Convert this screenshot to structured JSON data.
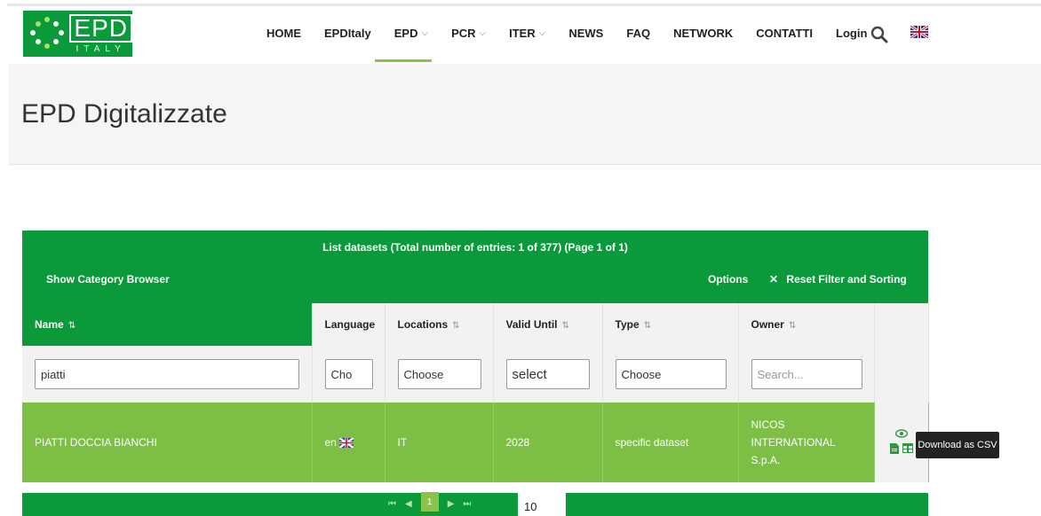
{
  "logo": {
    "main": "EPD",
    "sub": "ITALY"
  },
  "nav": {
    "items": [
      {
        "label": "HOME",
        "dropdown": false
      },
      {
        "label": "EPDItaly",
        "dropdown": false
      },
      {
        "label": "EPD",
        "dropdown": true
      },
      {
        "label": "PCR",
        "dropdown": true
      },
      {
        "label": "ITER",
        "dropdown": true
      },
      {
        "label": "NEWS",
        "dropdown": false
      },
      {
        "label": "FAQ",
        "dropdown": false
      },
      {
        "label": "NETWORK",
        "dropdown": false
      },
      {
        "label": "CONTATTI",
        "dropdown": false
      },
      {
        "label": "Login",
        "dropdown": false
      }
    ],
    "chevron": "⌵",
    "active_item": "EPD",
    "icons": [
      "search-icon",
      "uk-flag-icon"
    ]
  },
  "page": {
    "title": "EPD Digitalizzate"
  },
  "datasets": {
    "list_title": "List datasets (Total number of entries: 1 of 377) (Page 1 of 1)",
    "show_category_browser": "Show Category Browser",
    "options": "Options",
    "reset_symbol": "✕",
    "reset": "Reset Filter and Sorting",
    "sort_icon": "⇅",
    "columns": {
      "name": "Name",
      "language": "Language",
      "locations": "Locations",
      "valid_until": "Valid Until",
      "type": "Type",
      "owner": "Owner"
    },
    "filters": {
      "name_value": "piatti",
      "language_value": "Cho",
      "locations_value": "Choose",
      "valid_until_value": "select",
      "type_value": "Choose",
      "owner_placeholder": "Search..."
    },
    "rows": [
      {
        "name": "PIATTI DOCCIA BIANCHI",
        "language": "en",
        "location": "IT",
        "valid_until": "2028",
        "type": "specific dataset",
        "owner_lines": [
          "NICOS",
          "INTERNATIONAL",
          "S.p.A."
        ]
      }
    ],
    "actions": {
      "view_icon": "eye-icon",
      "download_icons": [
        "document-icon",
        "table-icon"
      ]
    },
    "tooltip": "Download as CSV"
  },
  "pager": {
    "first": "⏮",
    "prev": "◀",
    "current": "1",
    "next": "▶",
    "last": "⏭",
    "page_size": "10"
  },
  "colors": {
    "brand_green": "#0a9a3a",
    "row_green": "#7dbf45",
    "accent": "#8bc34a"
  }
}
